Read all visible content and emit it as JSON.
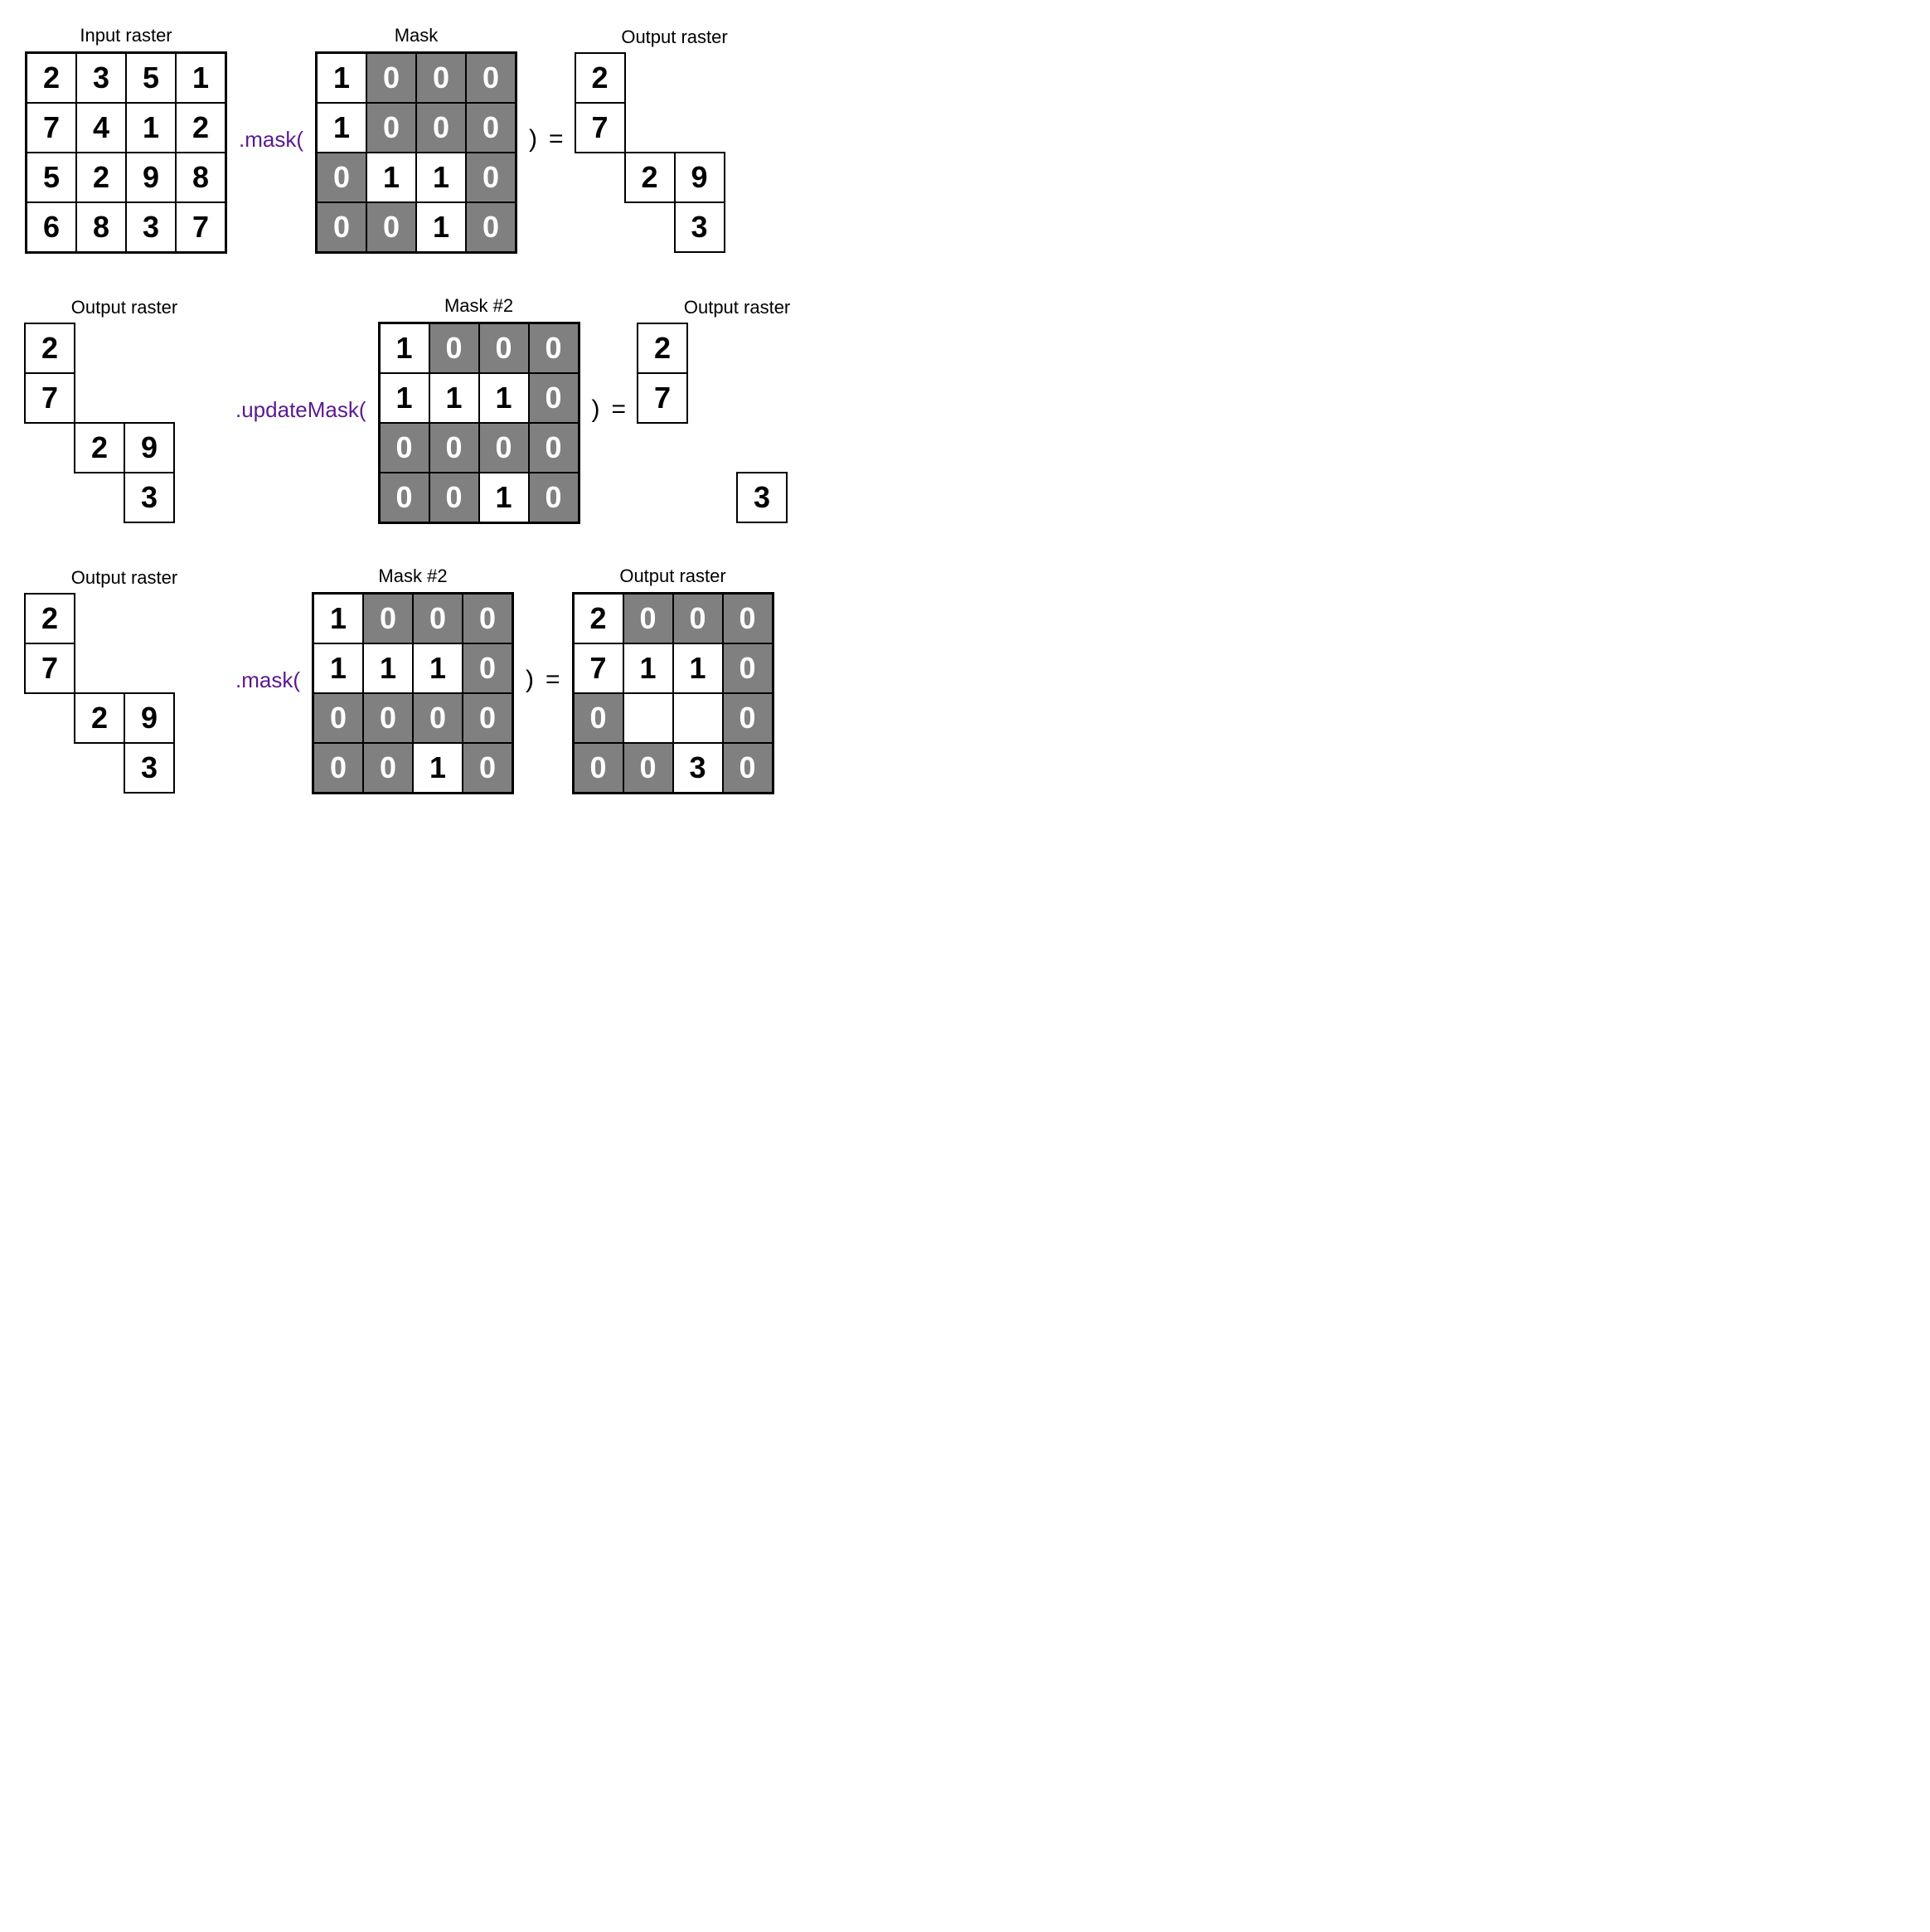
{
  "row1": {
    "input_title": "Input raster",
    "input": [
      [
        "2",
        "3",
        "5",
        "1"
      ],
      [
        "7",
        "4",
        "1",
        "2"
      ],
      [
        "5",
        "2",
        "9",
        "8"
      ],
      [
        "6",
        "8",
        "3",
        "7"
      ]
    ],
    "op": ".mask(",
    "mask_title": "Mask",
    "mask": [
      [
        "1",
        "0",
        "0",
        "0"
      ],
      [
        "1",
        "0",
        "0",
        "0"
      ],
      [
        "0",
        "1",
        "1",
        "0"
      ],
      [
        "0",
        "0",
        "1",
        "0"
      ]
    ],
    "close": ")",
    "eq": "=",
    "output_title": "Output raster",
    "output": [
      [
        "2",
        "",
        "",
        ""
      ],
      [
        "7",
        "",
        "",
        ""
      ],
      [
        "",
        "2",
        "9",
        ""
      ],
      [
        "",
        "",
        "3",
        ""
      ]
    ]
  },
  "row2": {
    "input_title": "Output raster",
    "input": [
      [
        "2",
        "",
        "",
        ""
      ],
      [
        "7",
        "",
        "",
        ""
      ],
      [
        "",
        "2",
        "9",
        ""
      ],
      [
        "",
        "",
        "3",
        ""
      ]
    ],
    "op": ".updateMask(",
    "mask_title": "Mask #2",
    "mask": [
      [
        "1",
        "0",
        "0",
        "0"
      ],
      [
        "1",
        "1",
        "1",
        "0"
      ],
      [
        "0",
        "0",
        "0",
        "0"
      ],
      [
        "0",
        "0",
        "1",
        "0"
      ]
    ],
    "close": ")",
    "eq": "=",
    "output_title": "Output raster",
    "output": [
      [
        "2",
        "",
        "",
        ""
      ],
      [
        "7",
        "",
        "",
        ""
      ],
      [
        "",
        "",
        "",
        ""
      ],
      [
        "",
        "",
        "3",
        ""
      ]
    ]
  },
  "row3": {
    "input_title": "Output raster",
    "input": [
      [
        "2",
        "",
        "",
        ""
      ],
      [
        "7",
        "",
        "",
        ""
      ],
      [
        "",
        "2",
        "9",
        ""
      ],
      [
        "",
        "",
        "3",
        ""
      ]
    ],
    "op": ".mask(",
    "mask_title": "Mask #2",
    "mask": [
      [
        "1",
        "0",
        "0",
        "0"
      ],
      [
        "1",
        "1",
        "1",
        "0"
      ],
      [
        "0",
        "0",
        "0",
        "0"
      ],
      [
        "0",
        "0",
        "1",
        "0"
      ]
    ],
    "close": ")",
    "eq": "=",
    "output_title": "Output raster",
    "output": [
      [
        {
          "v": "2",
          "t": "one"
        },
        {
          "v": "0",
          "t": "zero"
        },
        {
          "v": "0",
          "t": "zero"
        },
        {
          "v": "0",
          "t": "zero"
        }
      ],
      [
        {
          "v": "7",
          "t": "one"
        },
        {
          "v": "1",
          "t": "one"
        },
        {
          "v": "1",
          "t": "one"
        },
        {
          "v": "0",
          "t": "zero"
        }
      ],
      [
        {
          "v": "0",
          "t": "zero"
        },
        {
          "v": "",
          "t": "one"
        },
        {
          "v": "",
          "t": "one"
        },
        {
          "v": "0",
          "t": "zero"
        }
      ],
      [
        {
          "v": "0",
          "t": "zero"
        },
        {
          "v": "0",
          "t": "zero"
        },
        {
          "v": "3",
          "t": "one"
        },
        {
          "v": "0",
          "t": "zero"
        }
      ]
    ]
  },
  "chart_data": {
    "type": "table",
    "description": "Diagram illustrating mask() vs updateMask() on 4x4 rasters",
    "rows": [
      {
        "operation": "mask",
        "input_raster": [
          [
            2,
            3,
            5,
            1
          ],
          [
            7,
            4,
            1,
            2
          ],
          [
            5,
            2,
            9,
            8
          ],
          [
            6,
            8,
            3,
            7
          ]
        ],
        "mask": [
          [
            1,
            0,
            0,
            0
          ],
          [
            1,
            0,
            0,
            0
          ],
          [
            0,
            1,
            1,
            0
          ],
          [
            0,
            0,
            1,
            0
          ]
        ],
        "output_raster": [
          [
            2,
            null,
            null,
            null
          ],
          [
            7,
            null,
            null,
            null
          ],
          [
            null,
            2,
            9,
            null
          ],
          [
            null,
            null,
            3,
            null
          ]
        ]
      },
      {
        "operation": "updateMask",
        "input_raster": [
          [
            2,
            null,
            null,
            null
          ],
          [
            7,
            null,
            null,
            null
          ],
          [
            null,
            2,
            9,
            null
          ],
          [
            null,
            null,
            3,
            null
          ]
        ],
        "mask": [
          [
            1,
            0,
            0,
            0
          ],
          [
            1,
            1,
            1,
            0
          ],
          [
            0,
            0,
            0,
            0
          ],
          [
            0,
            0,
            1,
            0
          ]
        ],
        "output_raster": [
          [
            2,
            null,
            null,
            null
          ],
          [
            7,
            null,
            null,
            null
          ],
          [
            null,
            null,
            null,
            null
          ],
          [
            null,
            null,
            3,
            null
          ]
        ]
      },
      {
        "operation": "mask",
        "input_raster": [
          [
            2,
            null,
            null,
            null
          ],
          [
            7,
            null,
            null,
            null
          ],
          [
            null,
            2,
            9,
            null
          ],
          [
            null,
            null,
            3,
            null
          ]
        ],
        "mask": [
          [
            1,
            0,
            0,
            0
          ],
          [
            1,
            1,
            1,
            0
          ],
          [
            0,
            0,
            0,
            0
          ],
          [
            0,
            0,
            1,
            0
          ]
        ],
        "output_raster": [
          [
            2,
            0,
            0,
            0
          ],
          [
            7,
            1,
            1,
            0
          ],
          [
            0,
            null,
            null,
            0
          ],
          [
            0,
            0,
            3,
            0
          ]
        ]
      }
    ]
  }
}
